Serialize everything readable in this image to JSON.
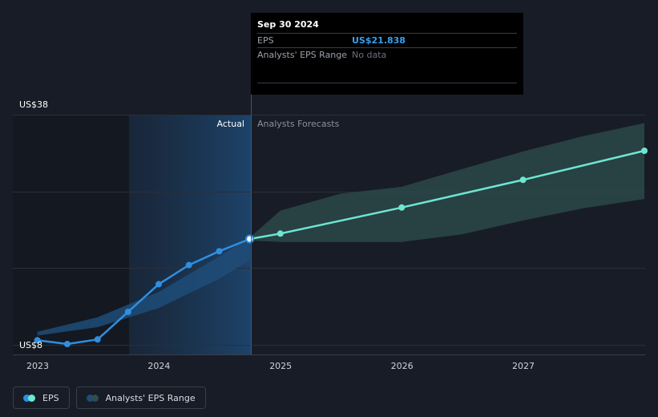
{
  "tooltip": {
    "date": "Sep 30 2024",
    "rows": [
      {
        "label": "EPS",
        "value": "US$21.838"
      },
      {
        "label": "Analysts' EPS Range",
        "value": "No data"
      }
    ]
  },
  "section_labels": {
    "actual": "Actual",
    "forecast": "Analysts Forecasts"
  },
  "legend": {
    "eps": "EPS",
    "range": "Analysts' EPS Range"
  },
  "colors": {
    "background": "#181c26",
    "actual_line": "#2e8fe0",
    "forecast_line": "#6de6d2",
    "forecast_band": "#2e4d4e",
    "actual_band": "#1f4c78"
  },
  "chart_data": {
    "type": "line",
    "y_labels": [
      "US$38",
      "US$8"
    ],
    "ylim": [
      8,
      38
    ],
    "x_ticks": [
      "2023",
      "2024",
      "2025",
      "2026",
      "2027"
    ],
    "xlim": [
      "2023-01-01",
      "2027-12-31"
    ],
    "actual_end": "2024-09-30",
    "series": [
      {
        "name": "EPS",
        "kind": "actual",
        "x": [
          "2022-12-31",
          "2023-03-31",
          "2023-06-30",
          "2023-09-30",
          "2023-12-31",
          "2024-03-31",
          "2024-06-30",
          "2024-09-30"
        ],
        "y": [
          8.6,
          8.1,
          8.7,
          12.3,
          15.9,
          18.4,
          20.2,
          21.8
        ]
      },
      {
        "name": "EPS",
        "kind": "forecast",
        "x": [
          "2024-09-30",
          "2024-12-31",
          "2025-12-31",
          "2026-12-31",
          "2027-12-31"
        ],
        "y": [
          21.8,
          22.5,
          25.9,
          29.5,
          33.3
        ]
      }
    ],
    "ranges": [
      {
        "name": "Analysts' EPS Range",
        "kind": "actual",
        "x": [
          "2022-12-31",
          "2023-06-30",
          "2023-12-31",
          "2024-06-30",
          "2024-09-30"
        ],
        "low": [
          9.2,
          10.3,
          12.8,
          16.6,
          19.0
        ],
        "high": [
          9.7,
          11.6,
          14.9,
          19.5,
          22.0
        ]
      },
      {
        "name": "Analysts' EPS Range",
        "kind": "forecast",
        "x": [
          "2024-09-30",
          "2024-12-31",
          "2025-06-30",
          "2025-12-31",
          "2026-06-30",
          "2026-12-31",
          "2027-06-30",
          "2027-12-31"
        ],
        "low": [
          21.6,
          21.4,
          21.4,
          21.4,
          22.4,
          24.2,
          25.8,
          27.0
        ],
        "high": [
          22.0,
          25.5,
          27.7,
          28.6,
          30.9,
          33.2,
          35.2,
          36.9
        ]
      }
    ]
  }
}
